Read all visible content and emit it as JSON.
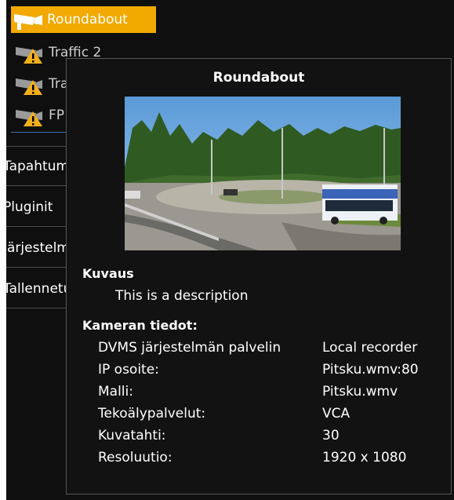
{
  "camera_tree": {
    "selected": {
      "label": "Roundabout",
      "icon": "camera-icon"
    },
    "items": [
      {
        "label": "Traffic 2",
        "icon": "camera-warning-icon"
      },
      {
        "label": "Traffic",
        "icon": "camera-warning-icon"
      },
      {
        "label": "FP",
        "icon": "camera-warning-icon"
      }
    ]
  },
  "menu": {
    "items": [
      {
        "label": "Tapahtumat ja hälytykset"
      },
      {
        "label": "Pluginit"
      },
      {
        "label": "Järjestelmänhallinta"
      },
      {
        "label": "Tallennetut"
      }
    ]
  },
  "tooltip": {
    "title": "Roundabout",
    "image_alt": "Roundabout camera snapshot",
    "description_heading": "Kuvaus",
    "description": "This is a description",
    "info_heading": "Kameran tiedot:",
    "info": [
      {
        "key": "DVMS järjestelmän palvelin",
        "value": "Local recorder"
      },
      {
        "key": "IP osoite:",
        "value": "Pitsku.wmv:80"
      },
      {
        "key": "Malli:",
        "value": "Pitsku.wmv"
      },
      {
        "key": "Tekoälypalvelut:",
        "value": "VCA"
      },
      {
        "key": "Kuvatahti:",
        "value": "30"
      },
      {
        "key": "Resoluutio:",
        "value": "1920 x 1080"
      }
    ]
  },
  "colors": {
    "selected_bg": "#f2a900",
    "warning": "#f2b01e",
    "panel_bg": "#0f0f0f"
  }
}
